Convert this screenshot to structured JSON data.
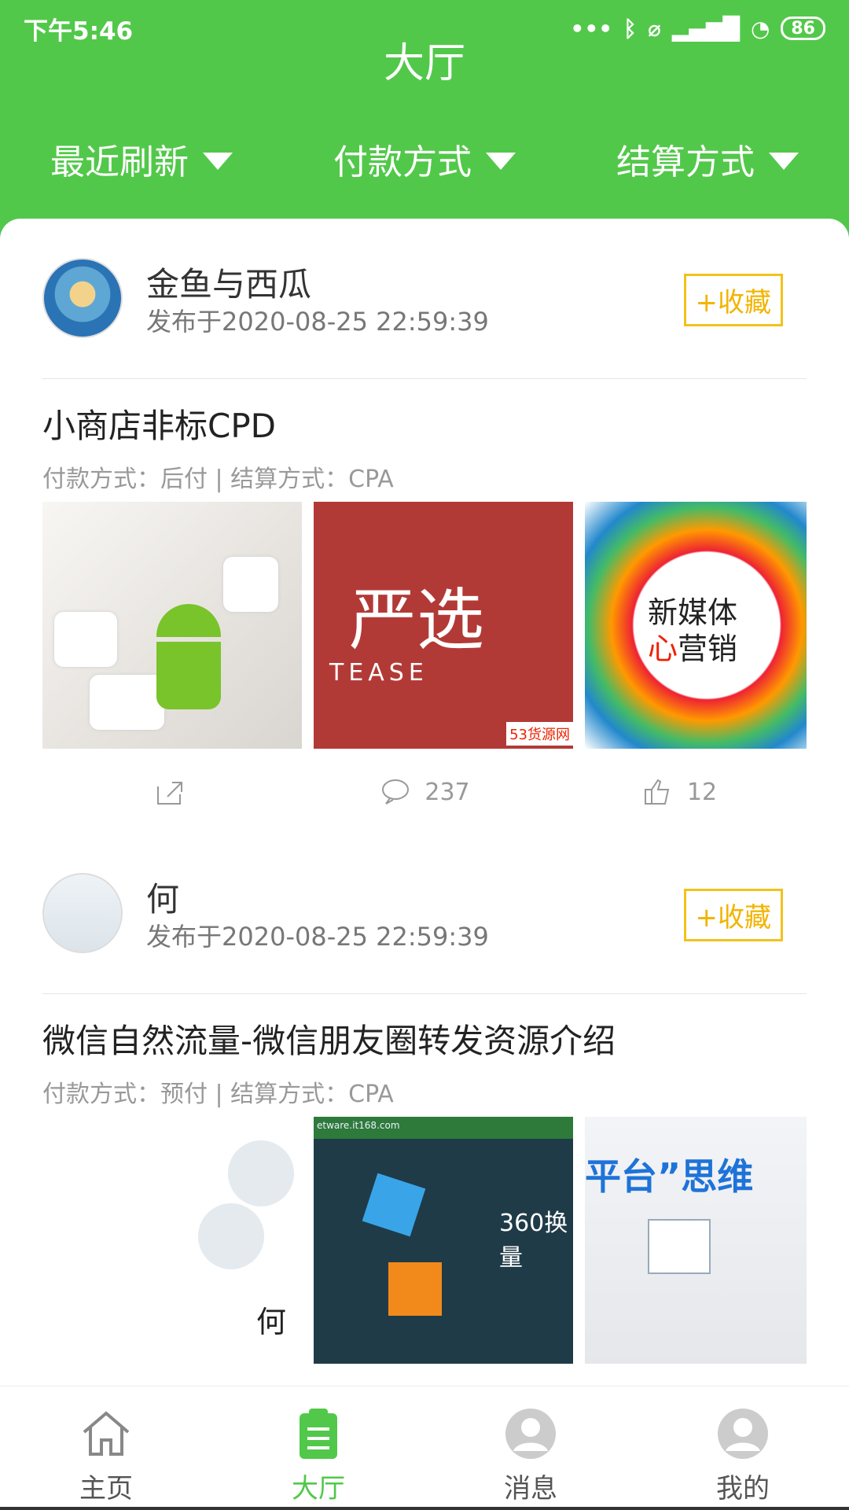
{
  "status_bar": {
    "time": "下午5:46",
    "battery": "86"
  },
  "header": {
    "title": "大厅",
    "filters": [
      {
        "label": "最近刷新"
      },
      {
        "label": "付款方式"
      },
      {
        "label": "结算方式"
      }
    ]
  },
  "posts": [
    {
      "author": "金鱼与西瓜",
      "time": "发布于2020-08-25 22:59:39",
      "favorite": "+收藏",
      "title": "小商店非标CPD",
      "meta": "付款方式：后付 | 结算方式：CPA",
      "comment_count": "237",
      "like_count": "12",
      "images": [
        {
          "icon": "android-marshmallow-image"
        },
        {
          "text": "严选",
          "small": "TEASE",
          "badge": "53货源网"
        },
        {
          "line1": "新媒体",
          "line2_red": "心",
          "line2": "营销"
        }
      ]
    },
    {
      "author": "何",
      "time": "发布于2020-08-25 22:59:39",
      "favorite": "+收藏",
      "title": "微信自然流量-微信朋友圈转发资源介绍",
      "meta": "付款方式：预付 | 结算方式：CPA",
      "images": [
        {
          "label": "何"
        },
        {
          "top": "etware.it168.com",
          "text": "360换量"
        },
        {
          "text": "平台”思维"
        }
      ]
    }
  ],
  "bottom_nav": [
    {
      "label": "主页",
      "icon": "home-icon"
    },
    {
      "label": "大厅",
      "icon": "clipboard-icon"
    },
    {
      "label": "消息",
      "icon": "message-icon"
    },
    {
      "label": "我的",
      "icon": "profile-icon"
    }
  ],
  "colors": {
    "primary": "#52c84a",
    "favorite": "#f2c21b"
  }
}
